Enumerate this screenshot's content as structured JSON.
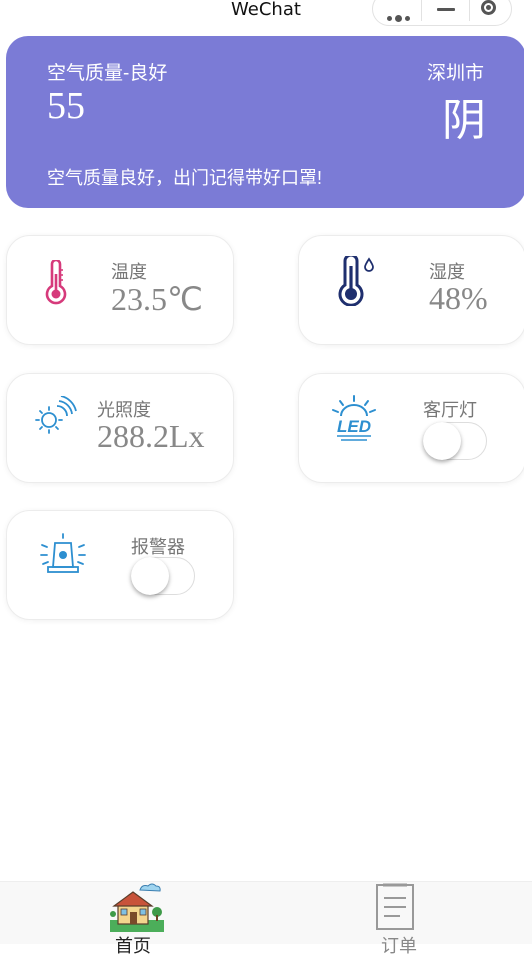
{
  "window": {
    "title": "WeChat"
  },
  "weather": {
    "air_quality_label": "空气质量-良好",
    "air_quality_value": "55",
    "city": "深圳市",
    "condition": "阴",
    "tip": "空气质量良好，出门记得带好口罩!"
  },
  "sensors": {
    "temperature": {
      "label": "温度",
      "value": "23.5℃",
      "icon": "thermometer-icon"
    },
    "humidity": {
      "label": "湿度",
      "value": "48%",
      "icon": "thermometer-humidity-icon"
    },
    "light": {
      "label": "光照度",
      "value": "288.2Lx",
      "icon": "sun-icon"
    },
    "living_room_light": {
      "label": "客厅灯",
      "state": "off",
      "icon": "led-icon"
    },
    "alarm": {
      "label": "报警器",
      "state": "off",
      "icon": "siren-icon"
    }
  },
  "tabbar": {
    "tabs": [
      {
        "label": "首页",
        "icon": "house-icon",
        "active": true
      },
      {
        "label": "订单",
        "icon": "document-icon",
        "active": false
      }
    ]
  },
  "colors": {
    "banner": "#7b7bd6",
    "temperature_icon": "#d63a7b",
    "humidity_icon": "#1f2f6e",
    "light_icon": "#2d8fd0"
  }
}
